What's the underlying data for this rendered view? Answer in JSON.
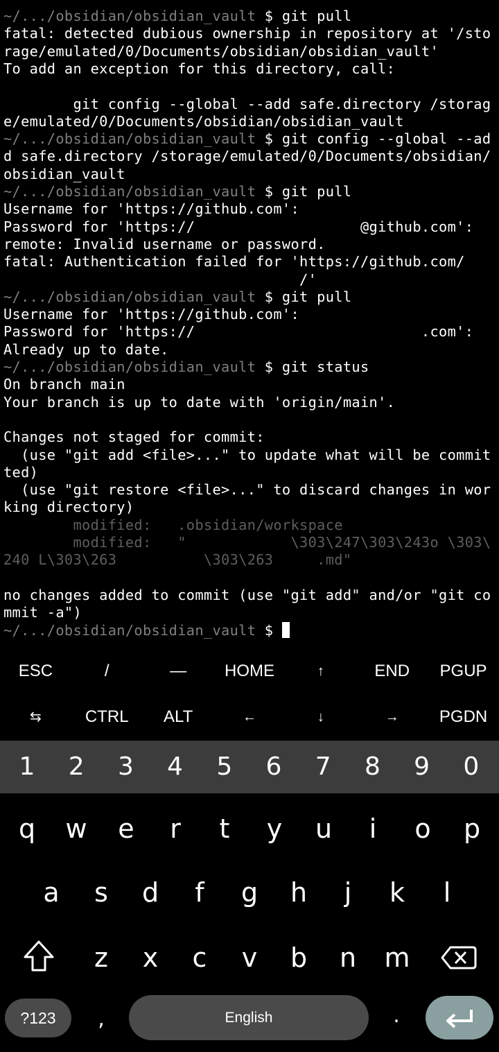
{
  "terminal": {
    "lines": [
      {
        "prompt": "~/.../obsidian/obsidian_vault",
        "cmd": " $ git pull"
      },
      {
        "text": "fatal: detected dubious ownership in repository at '/sto"
      },
      {
        "text": "rage/emulated/0/Documents/obsidian/obsidian_vault'"
      },
      {
        "text": "To add an exception for this directory, call:"
      },
      {
        "text": ""
      },
      {
        "text": "        git config --global --add safe.directory /storag"
      },
      {
        "text": "e/emulated/0/Documents/obsidian/obsidian_vault"
      },
      {
        "prompt": "~/.../obsidian/obsidian_vault",
        "cmd": " $ git config --global --ad"
      },
      {
        "text": "d safe.directory /storage/emulated/0/Documents/obsidian/"
      },
      {
        "text": "obsidian_vault"
      },
      {
        "prompt": "~/.../obsidian/obsidian_vault",
        "cmd": " $ git pull"
      },
      {
        "text": "Username for 'https://github.com':"
      },
      {
        "text": "Password for 'https://                   @github.com':"
      },
      {
        "text": "remote: Invalid username or password."
      },
      {
        "text": "fatal: Authentication failed for 'https://github.com/"
      },
      {
        "text": "                                  /'"
      },
      {
        "prompt": "~/.../obsidian/obsidian_vault",
        "cmd": " $ git pull"
      },
      {
        "text": "Username for 'https://github.com':"
      },
      {
        "text": "Password for 'https://                          .com':"
      },
      {
        "text": "Already up to date."
      },
      {
        "prompt": "~/.../obsidian/obsidian_vault",
        "cmd": " $ git status"
      },
      {
        "text": "On branch main"
      },
      {
        "text": "Your branch is up to date with 'origin/main'."
      },
      {
        "text": ""
      },
      {
        "text": "Changes not staged for commit:"
      },
      {
        "text": "  (use \"git add <file>...\" to update what will be commit"
      },
      {
        "text": "ted)"
      },
      {
        "text": "  (use \"git restore <file>...\" to discard changes in wor"
      },
      {
        "text": "king directory)"
      },
      {
        "mod": "        modified:   .obsidian/workspace"
      },
      {
        "mod": "        modified:   \"            \\303\\247\\303\\243o \\303\\"
      },
      {
        "mod": "240 L\\303\\263          \\303\\263     .md\""
      },
      {
        "text": ""
      },
      {
        "text": "no changes added to commit (use \"git add\" and/or \"git co"
      },
      {
        "text": "mmit -a\")"
      },
      {
        "prompt": "~/.../obsidian/obsidian_vault",
        "cmd": " $ ",
        "cursor": true
      }
    ]
  },
  "extra_keys": {
    "row1": [
      "ESC",
      "/",
      "—",
      "HOME",
      "↑",
      "END",
      "PGUP"
    ],
    "row2": [
      "⇆",
      "CTRL",
      "ALT",
      "←",
      "↓",
      "→",
      "PGDN"
    ]
  },
  "keyboard": {
    "numbers": [
      "1",
      "2",
      "3",
      "4",
      "5",
      "6",
      "7",
      "8",
      "9",
      "0"
    ],
    "row1": [
      "q",
      "w",
      "e",
      "r",
      "t",
      "y",
      "u",
      "i",
      "o",
      "p"
    ],
    "row2": [
      "a",
      "s",
      "d",
      "f",
      "g",
      "h",
      "j",
      "k",
      "l"
    ],
    "row3": [
      "z",
      "x",
      "c",
      "v",
      "b",
      "n",
      "m"
    ],
    "symbols_label": "?123",
    "comma": ",",
    "space_label": "English",
    "period": "."
  }
}
